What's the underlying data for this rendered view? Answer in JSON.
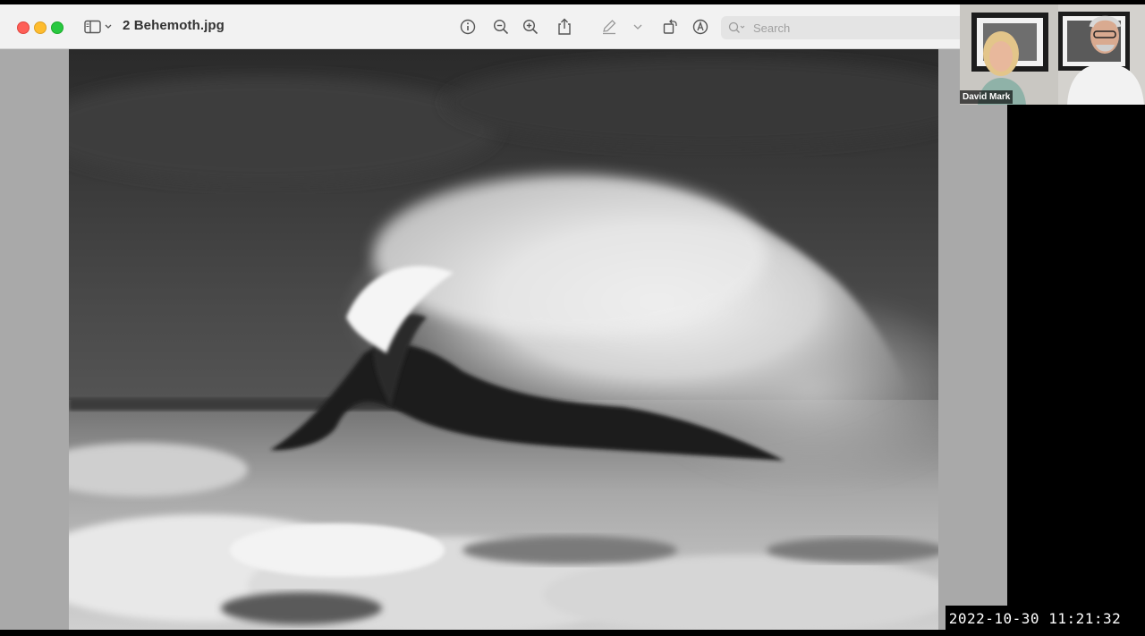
{
  "window": {
    "title": "2 Behemoth.jpg",
    "search_placeholder": "Search",
    "toolbar": {
      "sidebar_icon": "sidebar-icon",
      "info_icon": "info-icon",
      "zoom_out_icon": "zoom-out-icon",
      "zoom_in_icon": "zoom-in-icon",
      "share_icon": "share-icon",
      "markup_icon": "pen-icon",
      "rotate_icon": "rotate-icon",
      "annotate_icon": "markup-circle-icon"
    }
  },
  "video_call": {
    "participant_name": "David Mark"
  },
  "timestamp": "2022-10-30  11:21:32",
  "colors": {
    "close": "#fe5f57",
    "minimize": "#febc2e",
    "maximize": "#28c840",
    "titlebar": "#f2f2f2",
    "canvas": "#a9a9a9"
  }
}
